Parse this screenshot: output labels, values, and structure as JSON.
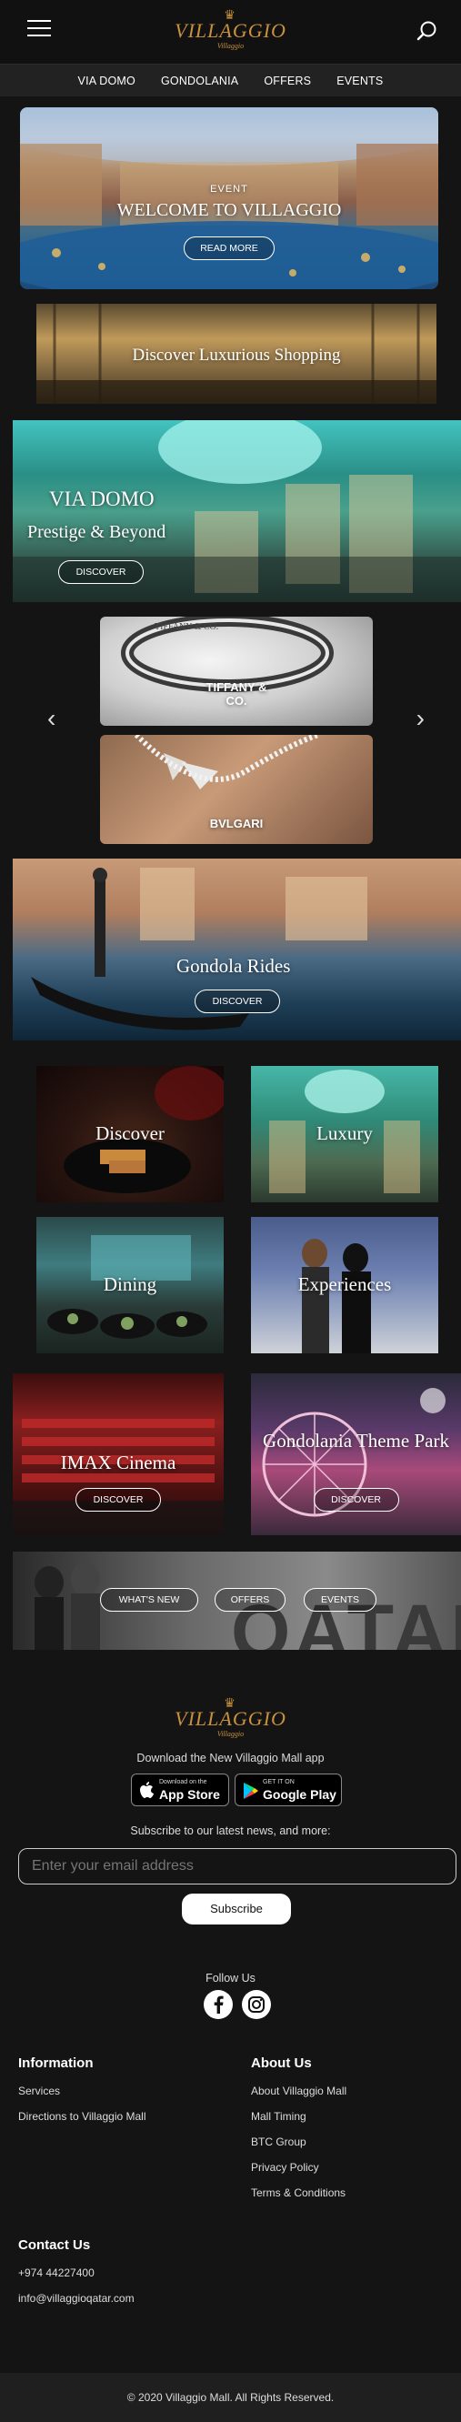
{
  "header": {
    "logo_text": "VILLAGGIO",
    "logo_sub": "Villaggio"
  },
  "nav": {
    "items": [
      "VIA DOMO",
      "GONDOLANIA",
      "OFFERS",
      "EVENTS"
    ]
  },
  "hero": {
    "tag": "EVENT",
    "title": "WELCOME TO VILLAGGIO",
    "button": "READ MORE"
  },
  "shopping": {
    "title": "Discover Luxurious Shopping"
  },
  "via_domo": {
    "title": "VIA DOMO",
    "subtitle": "Prestige & Beyond",
    "button": "DISCOVER"
  },
  "brands": {
    "items": [
      {
        "label": "TIFFANY &\nCO.",
        "engraving": "TIFFANY & CO."
      },
      {
        "label": "BVLGARI"
      }
    ],
    "prev_label": "‹",
    "next_label": "›"
  },
  "gondola": {
    "title": "Gondola Rides",
    "button": "DISCOVER"
  },
  "tiles": {
    "discover": "Discover",
    "luxury": "Luxury",
    "dining": "Dining",
    "experiences": "Experiences",
    "imax": {
      "title": "IMAX Cinema",
      "button": "DISCOVER"
    },
    "gondolania": {
      "title": "Gondolania Theme Park",
      "button": "DISCOVER"
    }
  },
  "banner": {
    "buttons": [
      "WHAT'S NEW",
      "OFFERS",
      "EVENTS"
    ],
    "bg_text": "QATAR"
  },
  "footer": {
    "logo_text": "VILLAGGIO",
    "logo_sub": "Villaggio",
    "download_text": "Download the New Villaggio Mall app",
    "app_store": {
      "small": "Download on the",
      "big": "App Store"
    },
    "google_play": {
      "small": "GET IT ON",
      "big": "Google Play"
    },
    "subscribe_text": "Subscribe to our latest news, and more:",
    "email_placeholder": "Enter your email address",
    "subscribe_button": "Subscribe",
    "follow_us": "Follow Us",
    "social_icons": [
      "facebook-icon",
      "instagram-icon"
    ],
    "information": {
      "heading": "Information",
      "links": [
        "Services",
        "Directions to Villaggio Mall"
      ]
    },
    "about": {
      "heading": "About Us",
      "links": [
        "About Villaggio Mall",
        "Mall Timing",
        "BTC Group",
        "Privacy Policy",
        "Terms & Conditions"
      ]
    },
    "contact": {
      "heading": "Contact Us",
      "phone": "+974 44227400",
      "email": "info@villaggioqatar.com"
    },
    "copyright": "© 2020 Villaggio Mall. All Rights Reserved."
  },
  "colors": {
    "brand_gold": "#c8913e",
    "background": "#141414"
  }
}
